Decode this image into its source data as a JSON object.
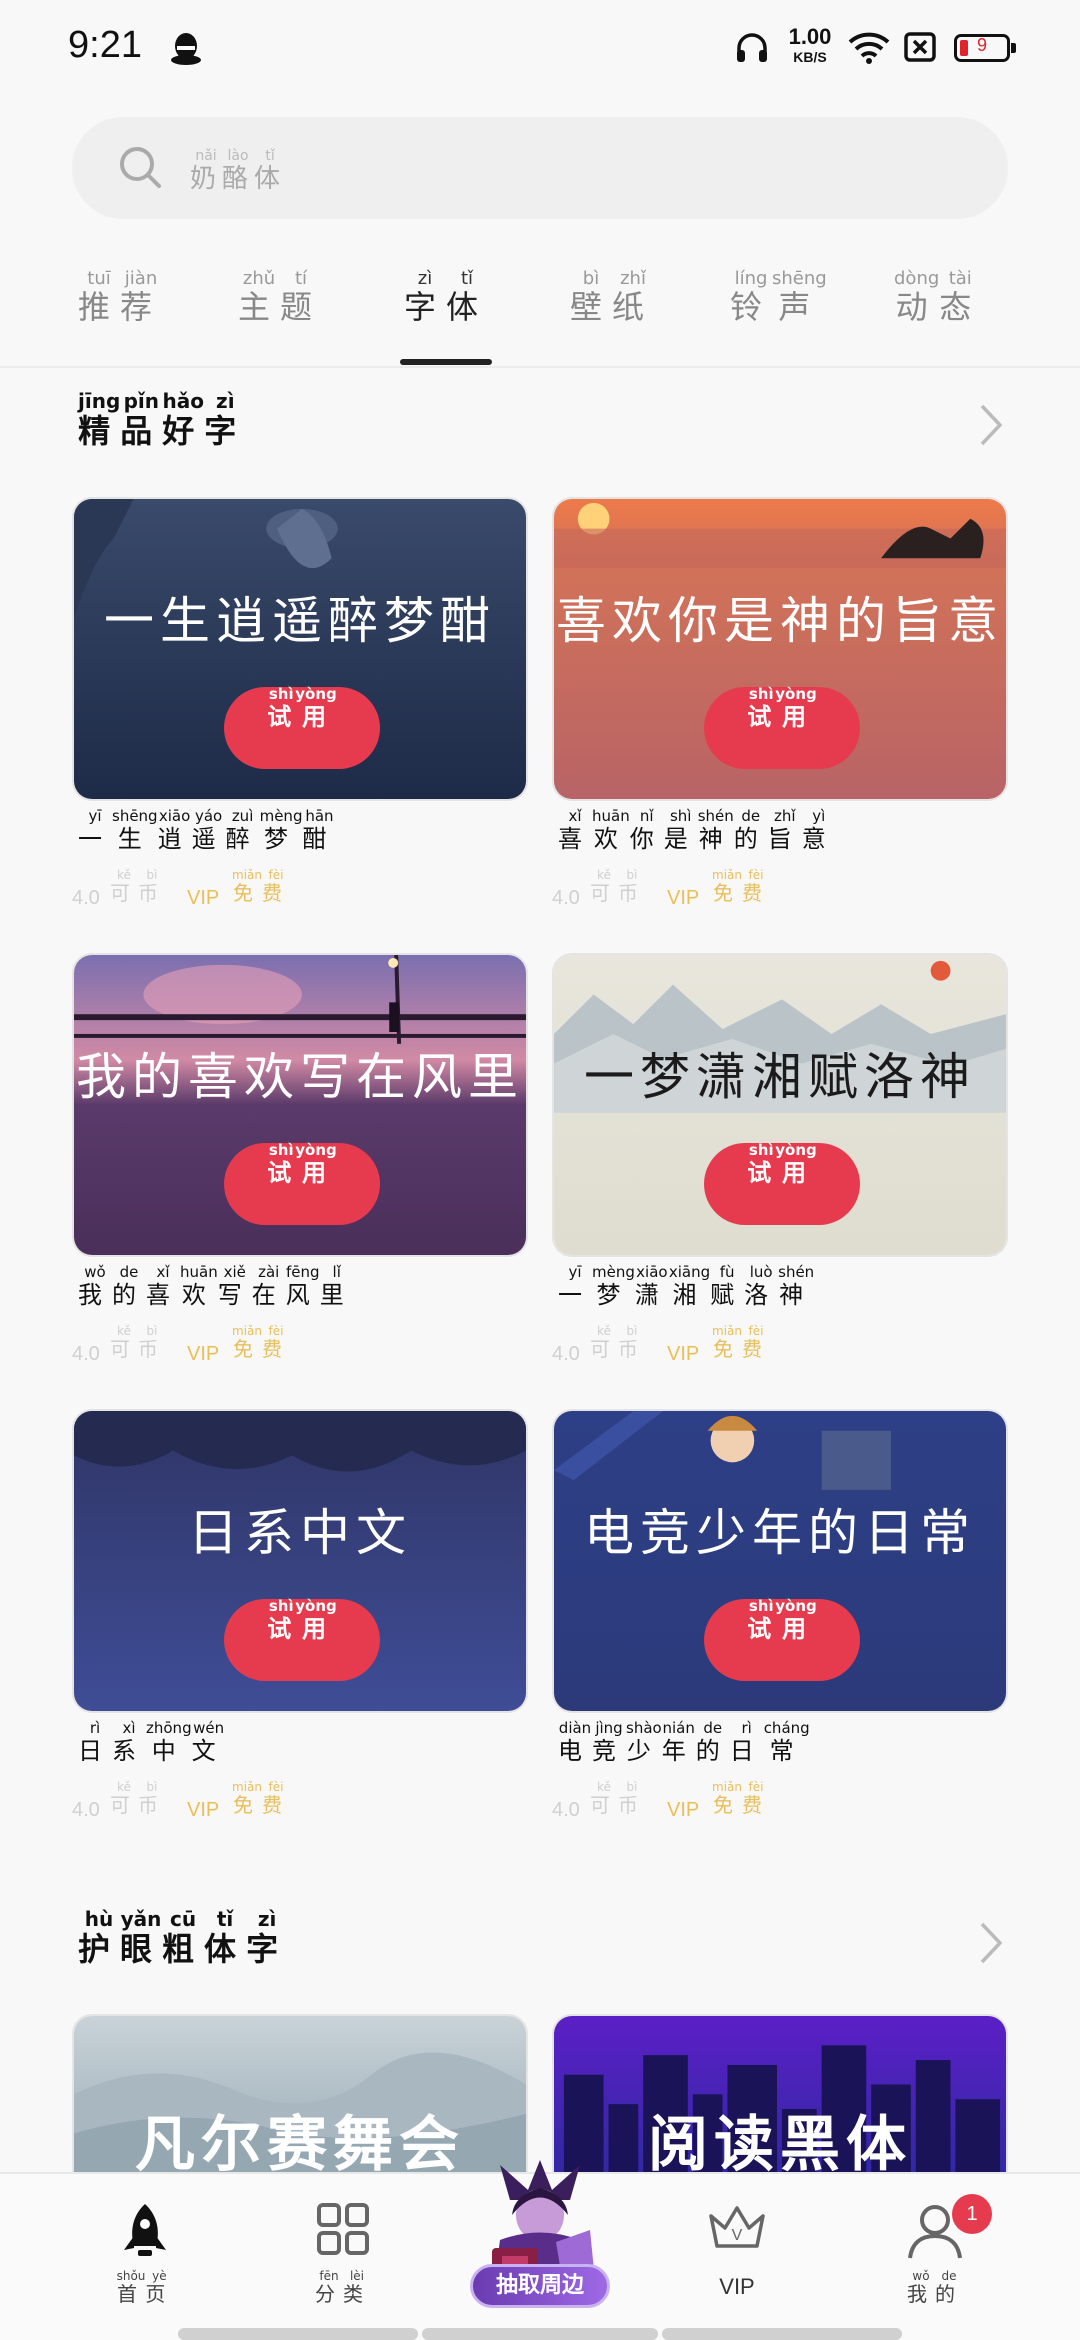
{
  "status": {
    "time": "9:21",
    "speed_value": "1.00",
    "speed_unit": "KB/S",
    "battery": "9"
  },
  "search": {
    "placeholder_text": "奶酪体",
    "placeholder_pinyin": [
      "nǎi",
      "lào",
      "tǐ"
    ]
  },
  "tabs": [
    {
      "label": "推荐",
      "pinyin": "tuī jiàn",
      "active": false
    },
    {
      "label": "主题",
      "pinyin": "zhǔ tí",
      "active": false
    },
    {
      "label": "字体",
      "pinyin": "zì tǐ",
      "active": true
    },
    {
      "label": "壁纸",
      "pinyin": "bì zhǐ",
      "active": false
    },
    {
      "label": "铃声",
      "pinyin": "líng shēng",
      "active": false
    },
    {
      "label": "动态",
      "pinyin": "dòng tài",
      "active": false
    }
  ],
  "section1": {
    "title": "精品好字",
    "pinyin": "jīng pǐn hǎo zì"
  },
  "section2": {
    "title": "护眼粗体字",
    "pinyin": "hù yǎn cū tǐ zì"
  },
  "try_button": {
    "label": "试用",
    "pinyin": "shì yòng"
  },
  "meta": {
    "score": "4.0",
    "coin": "可币",
    "coin_pinyin": "kě bì",
    "vip": "VIP",
    "free": "免费",
    "free_pinyin": "miǎn fèi"
  },
  "fonts": [
    {
      "name": "一生逍遥醉梦酣",
      "pinyin": [
        "yī",
        "shēng",
        "xiāo",
        "yáo",
        "zuì",
        "mèng",
        "hān"
      ],
      "card_title": "一生逍遥醉梦酣"
    },
    {
      "name": "喜欢你是神的旨意",
      "pinyin": [
        "xǐ",
        "huān",
        "nǐ",
        "shì",
        "shén",
        "de",
        "zhǐ",
        "yì"
      ],
      "card_title": "喜欢你是神的旨意"
    },
    {
      "name": "我的喜欢写在风里",
      "pinyin": [
        "wǒ",
        "de",
        "xǐ",
        "huān",
        "xiě",
        "zài",
        "fēng",
        "lǐ"
      ],
      "card_title": "我的喜欢写在风里"
    },
    {
      "name": "一梦潇湘赋洛神",
      "pinyin": [
        "yī",
        "mèng",
        "xiāo",
        "xiāng",
        "fù",
        "luò",
        "shén"
      ],
      "card_title": "一梦潇湘赋洛神"
    },
    {
      "name": "日系中文",
      "pinyin": [
        "rì",
        "xì",
        "zhōng",
        "wén"
      ],
      "card_title": "日系中文"
    },
    {
      "name": "电竞少年的日常",
      "pinyin": [
        "diàn",
        "jìng",
        "shào",
        "nián",
        "de",
        "rì",
        "cháng"
      ],
      "card_title": "电竞少年的日常"
    }
  ],
  "section2_cards": [
    {
      "card_title": "凡尔赛舞会"
    },
    {
      "card_title": "阅读黑体"
    }
  ],
  "nav": [
    {
      "label": "首页",
      "pinyin": "shǒu yè",
      "icon": "rocket-icon"
    },
    {
      "label": "分类",
      "pinyin": "fēn lèi",
      "icon": "grid-icon"
    },
    {
      "label": "抽取周边",
      "icon": "promo-character-icon"
    },
    {
      "label": "VIP",
      "icon": "crown-icon"
    },
    {
      "label": "我的",
      "pinyin": "wǒ de",
      "icon": "user-icon",
      "badge": "1"
    }
  ],
  "colors": {
    "accent": "#e63b4e",
    "vip_gold": "#e9bf5a",
    "promo_purple": "#7d4bc8"
  }
}
